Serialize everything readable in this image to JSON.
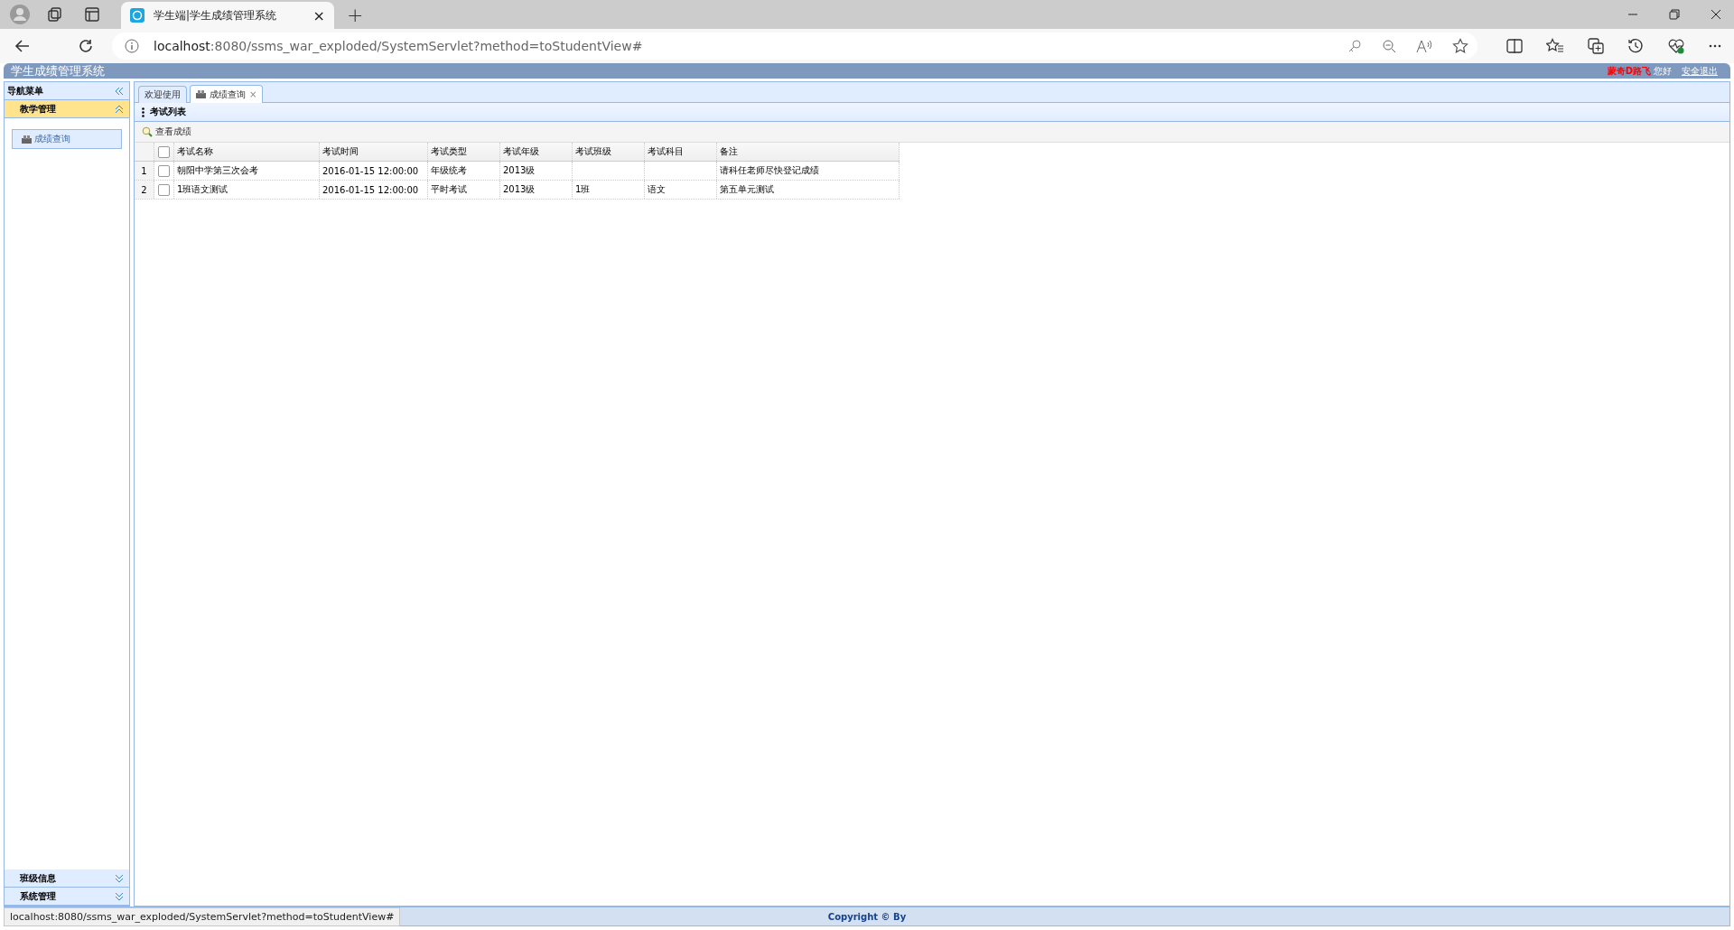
{
  "browser": {
    "tab_title": "学生端|学生成绩管理系统",
    "tab_close": "×",
    "new_tab": "+",
    "url_host": "localhost",
    "url_rest": ":8080/ssms_war_exploded/SystemServlet?method=toStudentView#",
    "status_url": "localhost:8080/ssms_war_exploded/SystemServlet?method=toStudentView#"
  },
  "header": {
    "title": "学生成绩管理系统",
    "user_name": "蒙奇D路飞",
    "greeting": "您好",
    "logout": "安全退出"
  },
  "sidebar": {
    "title": "导航菜单",
    "panels": [
      {
        "label": "教学管理",
        "expanded": true,
        "items": [
          {
            "label": "成绩查询",
            "selected": true
          }
        ]
      },
      {
        "label": "班级信息",
        "expanded": false
      },
      {
        "label": "系统管理",
        "expanded": false
      }
    ]
  },
  "tabs": [
    {
      "label": "欢迎使用",
      "selected": false,
      "closable": false
    },
    {
      "label": "成绩查询",
      "selected": true,
      "closable": true
    }
  ],
  "tab_close": "×",
  "panel": {
    "title": "考试列表",
    "toolbar": [
      "查看成绩"
    ]
  },
  "table": {
    "columns": [
      "考试名称",
      "考试时间",
      "考试类型",
      "考试年级",
      "考试班级",
      "考试科目",
      "备注"
    ],
    "header_checked": false,
    "rows": [
      {
        "index": "1",
        "checked": false,
        "cells": [
          "朝阳中学第三次会考",
          "2016-01-15 12:00:00",
          "年级统考",
          "2013级",
          "",
          "",
          "请科任老师尽快登记成绩"
        ]
      },
      {
        "index": "2",
        "checked": false,
        "cells": [
          "1班语文测试",
          "2016-01-15 12:00:00",
          "平时考试",
          "2013级",
          "1班",
          "语文",
          "第五单元测试"
        ]
      }
    ]
  },
  "footer": {
    "copyright": "Copyright © By"
  }
}
